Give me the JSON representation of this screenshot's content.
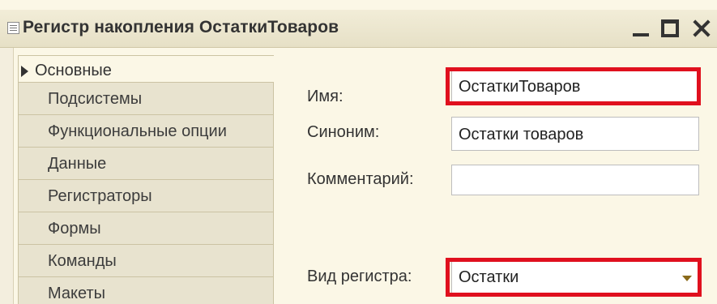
{
  "window": {
    "title": "Регистр накопления ОстаткиТоваров",
    "icon": "register-icon",
    "controls": [
      "minimize-icon",
      "maximize-icon",
      "close-icon"
    ]
  },
  "sidebar": {
    "items": [
      {
        "label": "Основные",
        "active": true
      },
      {
        "label": "Подсистемы"
      },
      {
        "label": "Функциональные опции"
      },
      {
        "label": "Данные"
      },
      {
        "label": "Регистраторы"
      },
      {
        "label": "Формы"
      },
      {
        "label": "Команды"
      },
      {
        "label": "Макеты"
      }
    ]
  },
  "form": {
    "name_label": "Имя:",
    "name_value": "ОстаткиТоваров",
    "synonym_label": "Синоним:",
    "synonym_value": "Остатки товаров",
    "comment_label": "Комментарий:",
    "comment_value": "",
    "register_type_label": "Вид регистра:",
    "register_type_value": "Остатки"
  },
  "colors": {
    "highlight": "#e0101e",
    "background": "#fbf7e6",
    "tab_inactive": "#e8e3cf"
  }
}
